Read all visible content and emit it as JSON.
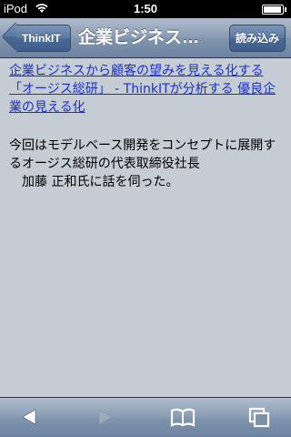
{
  "status_bar": {
    "carrier": "iPod",
    "time": "1:50"
  },
  "navbar": {
    "back_label": "ThinkIT",
    "title": "企業ビジネス…",
    "read_button_label": "読み込み"
  },
  "article": {
    "link_text": "企業ビジネスから顧客の望みを見える化する「オージス総研」 - ThinkITが分析する 優良企業の見える化",
    "description": "今回はモデルベース開発をコンセプトに展開するオージス総研の代表取締役社長\n　加藤 正和氏に話を伺った。"
  },
  "toolbar": {
    "icons": [
      "back-arrow-icon",
      "forward-arrow-icon",
      "bookmarks-icon",
      "pages-icon"
    ],
    "forward_enabled": false
  },
  "colors": {
    "background": "#c5ccd4",
    "link": "#1b2fcf",
    "bar": "#6d83a1"
  }
}
